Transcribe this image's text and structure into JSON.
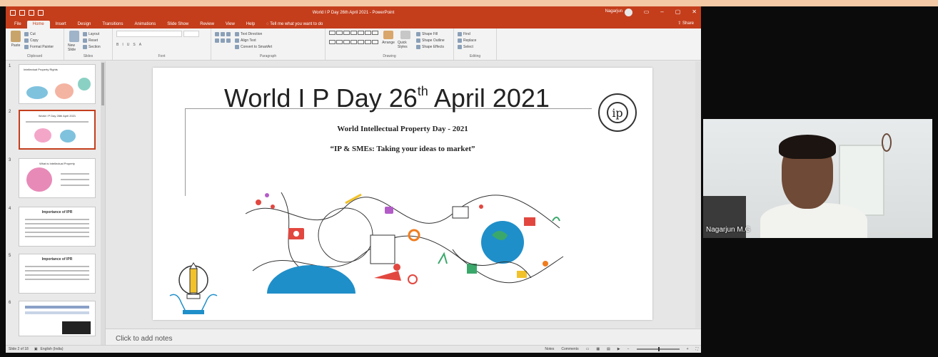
{
  "window": {
    "title": "World I P Day 26th April 2021 - PowerPoint",
    "user": "Nagarjun",
    "share_label": "Share"
  },
  "ribbon": {
    "tabs": [
      "File",
      "Home",
      "Insert",
      "Design",
      "Transitions",
      "Animations",
      "Slide Show",
      "Review",
      "View",
      "Help"
    ],
    "tell_me": "Tell me what you want to do",
    "groups": {
      "clipboard": {
        "label": "Clipboard",
        "paste": "Paste",
        "cut": "Cut",
        "copy": "Copy",
        "format_painter": "Format Painter"
      },
      "slides": {
        "label": "Slides",
        "new_slide": "New Slide",
        "layout": "Layout",
        "reset": "Reset",
        "section": "Section"
      },
      "font": {
        "label": "Font"
      },
      "paragraph": {
        "label": "Paragraph",
        "text_direction": "Text Direction",
        "align_text": "Align Text",
        "convert_smartart": "Convert to SmartArt"
      },
      "drawing": {
        "label": "Drawing",
        "arrange": "Arrange",
        "quick_styles": "Quick Styles",
        "shape_fill": "Shape Fill",
        "shape_outline": "Shape Outline",
        "shape_effects": "Shape Effects"
      },
      "editing": {
        "label": "Editing",
        "find": "Find",
        "replace": "Replace",
        "select": "Select"
      }
    }
  },
  "thumbnails": [
    {
      "num": "1",
      "title": "Intellectual Property Rights"
    },
    {
      "num": "2",
      "title": "World I P Day 26th April 2021"
    },
    {
      "num": "3",
      "title": "What is Intellectual Property"
    },
    {
      "num": "4",
      "title": "Importance of IPR"
    },
    {
      "num": "5",
      "title": "Importance of IPR"
    },
    {
      "num": "6",
      "title": ""
    }
  ],
  "slide": {
    "title_main": "World I P Day 26",
    "title_sup": "th",
    "title_end": " April 2021",
    "subtitle1": "World Intellectual Property Day - 2021",
    "subtitle2": "“IP & SMEs: Taking your ideas to market”",
    "logo_letters": "ip"
  },
  "notes_placeholder": "Click to add notes",
  "status": {
    "slide_info": "Slide 2 of 18",
    "language": "English (India)",
    "notes": "Notes",
    "comments": "Comments"
  },
  "video": {
    "participant_name": "Nagarjun M.G"
  },
  "colors": {
    "ppt_accent": "#c43e1c",
    "top_bar": "#f4c9a6"
  }
}
